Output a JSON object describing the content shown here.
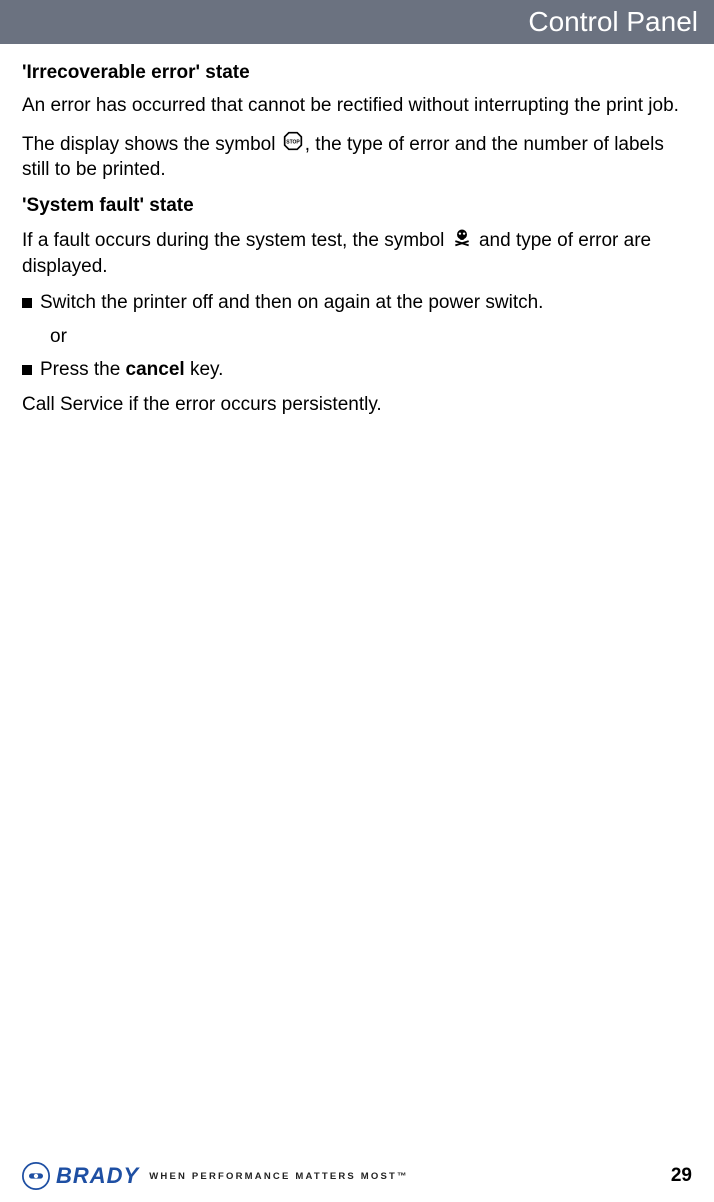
{
  "header": {
    "title": "Control Panel"
  },
  "section1": {
    "heading": "'Irrecoverable error' state",
    "p1": "An error has occurred that cannot be rectified without interrupting the print job.",
    "p2a": "The display shows the symbol ",
    "p2b": ", the type of error and the number of labels still to be printed."
  },
  "section2": {
    "heading": "'System fault' state",
    "p1a": "If a fault occurs during the system test, the symbol ",
    "p1b": " and type of error are displayed.",
    "bullet1": "Switch the printer off and then on again at the power switch.",
    "or": "or",
    "bullet2a": "Press the ",
    "bullet2b": "cancel",
    "bullet2c": " key.",
    "p2": "Call Service if the error occurs persistently."
  },
  "footer": {
    "brand": "BRADY",
    "tagline": "WHEN PERFORMANCE MATTERS MOST™",
    "page": "29"
  }
}
